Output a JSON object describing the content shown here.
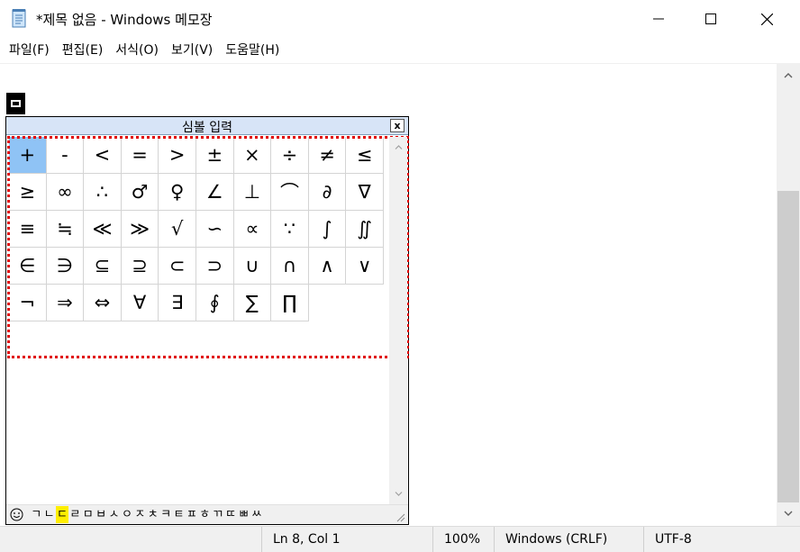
{
  "window": {
    "title": "*제목 없음 - Windows 메모장"
  },
  "menu": [
    {
      "label": "파일(F)"
    },
    {
      "label": "편집(E)"
    },
    {
      "label": "서식(O)"
    },
    {
      "label": "보기(V)"
    },
    {
      "label": "도움말(H)"
    }
  ],
  "symbol_panel": {
    "title": "심볼 입력",
    "close_label": "x",
    "selected_symbol": "+",
    "symbols": [
      "+",
      "-",
      "<",
      "=",
      ">",
      "±",
      "×",
      "÷",
      "≠",
      "≤",
      "≥",
      "∞",
      "∴",
      "♂",
      "♀",
      "∠",
      "⊥",
      "⌒",
      "∂",
      "∇",
      "≡",
      "≒",
      "≪",
      "≫",
      "√",
      "∽",
      "∝",
      "∵",
      "∫",
      "∬",
      "∈",
      "∋",
      "⊆",
      "⊇",
      "⊂",
      "⊃",
      "∪",
      "∩",
      "∧",
      "∨",
      "¬",
      "⇒",
      "⇔",
      "∀",
      "∃",
      "∮",
      "∑",
      "∏"
    ],
    "jamo_tabs": [
      "ㄱ",
      "ㄴ",
      "ㄷ",
      "ㄹ",
      "ㅁ",
      "ㅂ",
      "ㅅ",
      "ㅇ",
      "ㅈ",
      "ㅊ",
      "ㅋ",
      "ㅌ",
      "ㅍ",
      "ㅎ",
      "ㄲ",
      "ㄸ",
      "ㅃ",
      "ㅆ"
    ],
    "active_jamo": "ㄷ",
    "highlight_color": "#ffee00",
    "selection_color": "#8fc3f5",
    "outline_color": "#e00000"
  },
  "statusbar": {
    "position": "Ln 8, Col 1",
    "zoom": "100%",
    "line_ending": "Windows (CRLF)",
    "encoding": "UTF-8"
  }
}
